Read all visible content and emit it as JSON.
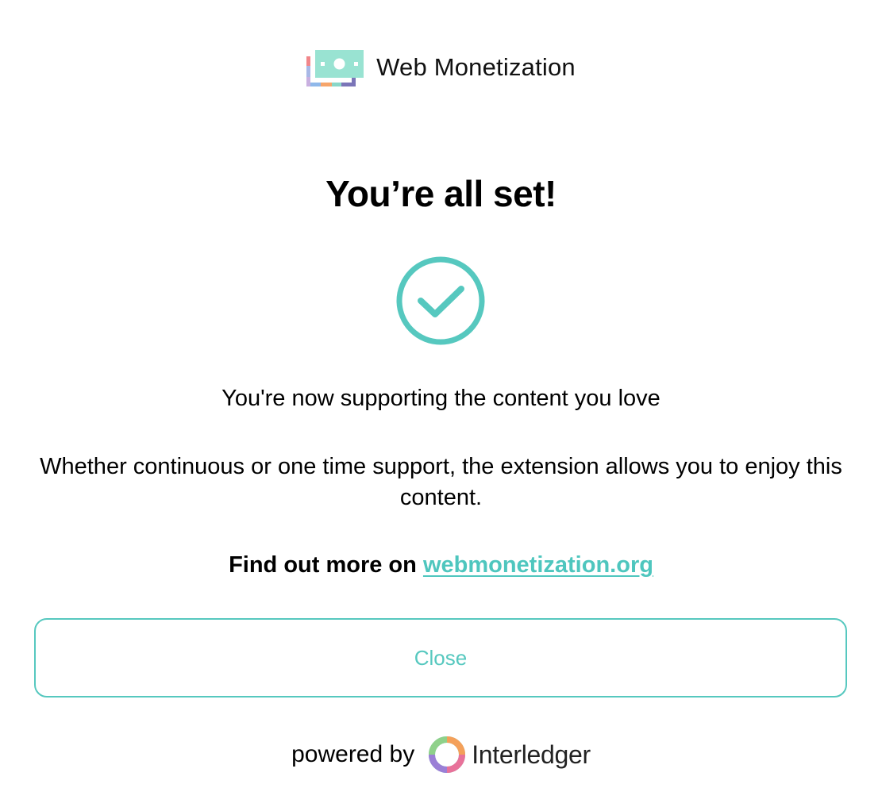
{
  "header": {
    "brand": "Web Monetization",
    "logo_icon": "web-monetization-logo-icon"
  },
  "main": {
    "title": "You’re all set!",
    "status_icon": "checkmark-circle-icon",
    "subtitle": "You're now supporting the content you love",
    "body": "Whether continuous or one time support, the extension allows you to enjoy this content.",
    "more_prefix": "Find out more on",
    "more_link": "webmonetization.org"
  },
  "actions": {
    "close_label": "Close"
  },
  "footer": {
    "powered_by": "powered by",
    "partner_name": "Interledger",
    "partner_icon": "interledger-logo-icon"
  },
  "colors": {
    "accent": "#56c8bf",
    "text": "#000000",
    "background": "#ffffff"
  }
}
